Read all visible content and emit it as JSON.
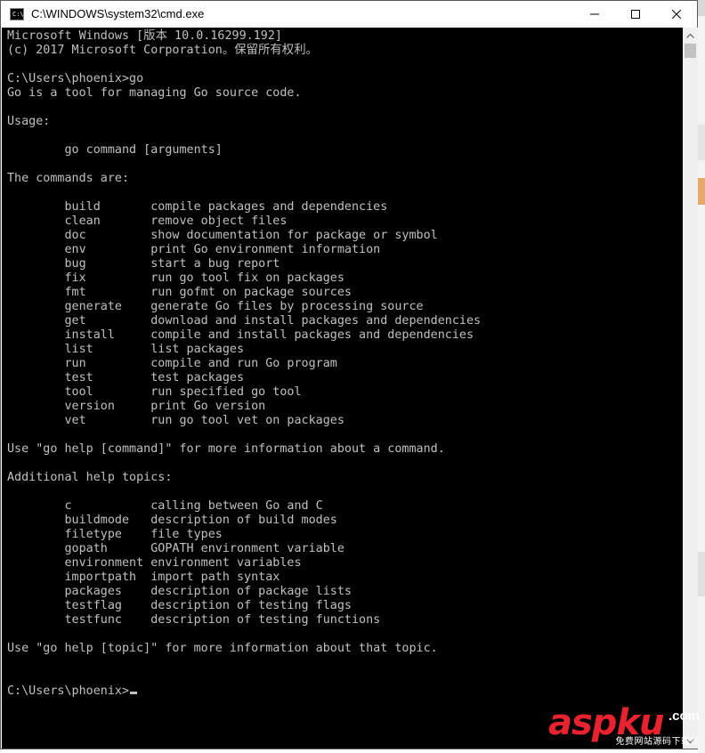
{
  "window": {
    "title": "C:\\WINDOWS\\system32\\cmd.exe",
    "icon": "cmd-icon",
    "controls": [
      "minimize-icon",
      "maximize-icon",
      "close-icon"
    ]
  },
  "console": {
    "colors": {
      "background": "#000000",
      "text": "#c0c0c0"
    },
    "lines": [
      "Microsoft Windows [版本 10.0.16299.192]",
      "(c) 2017 Microsoft Corporation。保留所有权利。",
      "",
      "C:\\Users\\phoenix>go",
      "Go is a tool for managing Go source code.",
      "",
      "Usage:",
      "",
      "        go command [arguments]",
      "",
      "The commands are:",
      "",
      "        build       compile packages and dependencies",
      "        clean       remove object files",
      "        doc         show documentation for package or symbol",
      "        env         print Go environment information",
      "        bug         start a bug report",
      "        fix         run go tool fix on packages",
      "        fmt         run gofmt on package sources",
      "        generate    generate Go files by processing source",
      "        get         download and install packages and dependencies",
      "        install     compile and install packages and dependencies",
      "        list        list packages",
      "        run         compile and run Go program",
      "        test        test packages",
      "        tool        run specified go tool",
      "        version     print Go version",
      "        vet         run go tool vet on packages",
      "",
      "Use \"go help [command]\" for more information about a command.",
      "",
      "Additional help topics:",
      "",
      "        c           calling between Go and C",
      "        buildmode   description of build modes",
      "        filetype    file types",
      "        gopath      GOPATH environment variable",
      "        environment environment variables",
      "        importpath  import path syntax",
      "        packages    description of package lists",
      "        testflag    description of testing flags",
      "        testfunc    description of testing functions",
      "",
      "Use \"go help [topic]\" for more information about that topic.",
      "",
      "",
      "C:\\Users\\phoenix>"
    ]
  },
  "watermark": {
    "main": "aspku",
    "suffix": ".com",
    "sub": "免费网站源码下载站",
    "color": "#e8232f"
  }
}
